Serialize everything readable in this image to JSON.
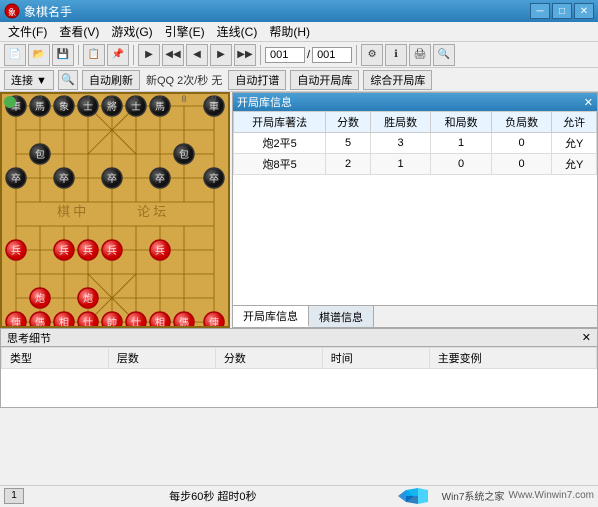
{
  "window": {
    "title": "象棋名手",
    "close_btn": "✕",
    "min_btn": "─",
    "max_btn": "□"
  },
  "menu": {
    "items": [
      {
        "label": "文件(F)"
      },
      {
        "label": "查看(V)"
      },
      {
        "label": "游戏(G)"
      },
      {
        "label": "引擎(E)"
      },
      {
        "label": "连线(C)"
      },
      {
        "label": "帮助(H)"
      }
    ]
  },
  "toolbar2": {
    "connect_btn": "连接 ▼",
    "auto_refresh_btn": "自动刷新",
    "new_qq_label": "新QQ 2次/秒 无",
    "auto_shoot_btn": "自动打谱",
    "auto_open_btn": "自动开局库",
    "composite_btn": "综合开局库",
    "counter": "001/001"
  },
  "opening_panel": {
    "title": "开局库信息",
    "close_btn": "✕",
    "columns": [
      "开局库著法",
      "分数",
      "胜局数",
      "和局数",
      "负局数",
      "允许"
    ],
    "rows": [
      {
        "name": "炮2平5",
        "score": 5,
        "win": 3,
        "draw": 1,
        "lose": 0,
        "allow": "允Y"
      },
      {
        "name": "炮8平5",
        "score": 2,
        "win": 1,
        "draw": 0,
        "lose": 0,
        "allow": "允Y"
      }
    ],
    "tabs": [
      {
        "label": "开局库信息",
        "active": true
      },
      {
        "label": "棋谱信息",
        "active": false
      }
    ]
  },
  "thinking_panel": {
    "title": "思考细节",
    "close_btn": "✕",
    "columns": [
      "类型",
      "层数",
      "分数",
      "时间",
      "主要变例"
    ]
  },
  "status_bar": {
    "left_text": "",
    "middle_text": "每步60秒  超时0秒",
    "site_text": "Www.Winwin7.com"
  },
  "board": {
    "pieces_black": [
      {
        "char": "車",
        "col": 0,
        "row": 0
      },
      {
        "char": "馬",
        "col": 1,
        "row": 0
      },
      {
        "char": "象",
        "col": 2,
        "row": 0
      },
      {
        "char": "士",
        "col": 3,
        "row": 0
      },
      {
        "char": "將",
        "col": 4,
        "row": 0
      },
      {
        "char": "士",
        "col": 5,
        "row": 0
      },
      {
        "char": "馬",
        "col": 6,
        "row": 0
      },
      {
        "char": "車",
        "col": 7,
        "row": 0
      },
      {
        "char": "包",
        "col": 1,
        "row": 2
      },
      {
        "char": "包",
        "col": 6,
        "row": 2
      },
      {
        "char": "卒",
        "col": 0,
        "row": 3
      },
      {
        "char": "卒",
        "col": 2,
        "row": 3
      },
      {
        "char": "卒",
        "col": 4,
        "row": 3
      },
      {
        "char": "卒",
        "col": 6,
        "row": 3
      },
      {
        "char": "卒",
        "col": 7,
        "row": 3
      }
    ],
    "pieces_red": [
      {
        "char": "兵",
        "col": 0,
        "row": 5
      },
      {
        "char": "兵",
        "col": 2,
        "row": 5
      },
      {
        "char": "兵",
        "col": 3,
        "row": 5
      },
      {
        "char": "兵",
        "col": 4,
        "row": 5
      },
      {
        "char": "兵",
        "col": 6,
        "row": 5
      },
      {
        "char": "炮",
        "col": 1,
        "row": 7
      },
      {
        "char": "炮",
        "col": 3,
        "row": 7
      },
      {
        "char": "傌",
        "col": 1,
        "row": 9
      },
      {
        "char": "相",
        "col": 2,
        "row": 9
      },
      {
        "char": "仕",
        "col": 3,
        "row": 9
      },
      {
        "char": "帥",
        "col": 4,
        "row": 9
      },
      {
        "char": "仕",
        "col": 5,
        "row": 9
      },
      {
        "char": "相",
        "col": 6,
        "row": 9
      },
      {
        "char": "傌",
        "col": 7,
        "row": 9
      },
      {
        "char": "俥",
        "col": 8,
        "row": 9
      }
    ]
  },
  "watermark": "棋 中 论 坛",
  "accent_color": "#2a7db8",
  "board_color": "#d4a849"
}
